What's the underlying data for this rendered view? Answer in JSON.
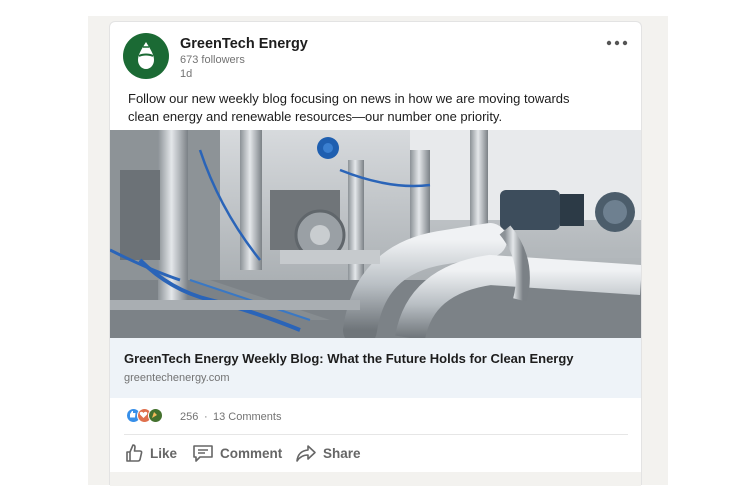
{
  "post": {
    "company_name": "GreenTech Energy",
    "followers": "673 followers",
    "age": "1d",
    "more_icon": "more-dots-icon",
    "text_line1": "Follow our new weekly blog focusing on news in how we are moving towards",
    "text_line2": "clean energy and renewable resources—our number one priority."
  },
  "link_preview": {
    "title": "GreenTech Energy Weekly Blog: What the Future Holds for Clean Energy",
    "domain": "greentechenergy.com"
  },
  "social": {
    "reaction_icons": [
      "like-icon",
      "love-icon",
      "celebrate-icon"
    ],
    "reaction_count": "256",
    "separator": "·",
    "comments": "13 Comments"
  },
  "actions": {
    "like": "Like",
    "comment": "Comment",
    "share": "Share"
  },
  "colors": {
    "brand_green": "#1b6a34",
    "like_blue": "#378fe9",
    "love_red": "#df704d",
    "celebrate_green": "#44712e"
  }
}
